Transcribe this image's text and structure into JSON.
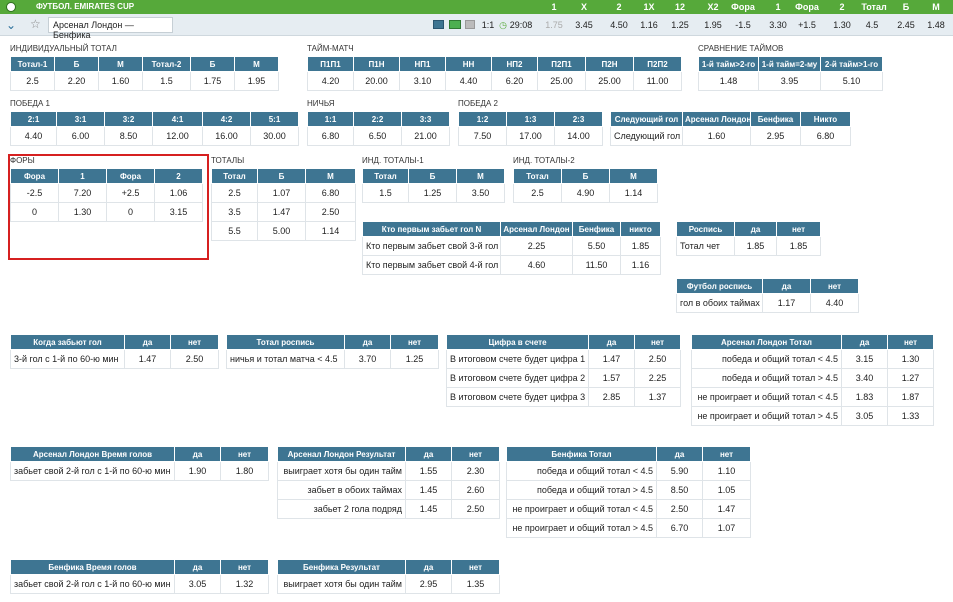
{
  "header": {
    "title": "ФУТБОЛ. EMIRATES CUP",
    "cols": [
      "1",
      "X",
      "2",
      "1X",
      "12",
      "X2",
      "Фора",
      "1",
      "Фора",
      "2",
      "Тотал",
      "Б",
      "М"
    ]
  },
  "match": {
    "name": "Арсенал Лондон — Бенфика",
    "score": "1:1",
    "time": "29:08",
    "odds": [
      "1.75",
      "3.45",
      "4.50",
      "1.16",
      "1.25",
      "1.95",
      "-1.5",
      "3.30",
      "+1.5",
      "1.30",
      "4.5",
      "2.45",
      "1.48"
    ]
  },
  "sections": {
    "ind_total": {
      "title": "ИНДИВИДУАЛЬНЫЙ ТОТАЛ",
      "head": [
        "Тотал-1",
        "Б",
        "М",
        "Тотал-2",
        "Б",
        "М"
      ],
      "rows": [
        [
          "2.5",
          "2.20",
          "1.60",
          "1.5",
          "1.75",
          "1.95"
        ]
      ]
    },
    "time_match": {
      "title": "ТАЙМ-МАТЧ",
      "head": [
        "П1П1",
        "П1Н",
        "НП1",
        "НН",
        "НП2",
        "П2П1",
        "П2Н",
        "П2П2"
      ],
      "rows": [
        [
          "4.20",
          "20.00",
          "3.10",
          "4.40",
          "6.20",
          "25.00",
          "25.00",
          "11.00"
        ]
      ]
    },
    "halves": {
      "title": "СРАВНЕНИЕ ТАЙМОВ",
      "head": [
        "1-й тайм>2-го",
        "1-й тайм=2-му",
        "2-й тайм>1-го"
      ],
      "rows": [
        [
          "1.48",
          "3.95",
          "5.10"
        ]
      ]
    },
    "win1": {
      "title": "ПОБЕДА 1",
      "head": [
        "2:1",
        "3:1",
        "3:2",
        "4:1",
        "4:2",
        "5:1"
      ],
      "rows": [
        [
          "4.40",
          "6.00",
          "8.50",
          "12.00",
          "16.00",
          "30.00"
        ]
      ]
    },
    "draw": {
      "title": "НИЧЬЯ",
      "head": [
        "1:1",
        "2:2",
        "3:3"
      ],
      "rows": [
        [
          "6.80",
          "6.50",
          "21.00"
        ]
      ]
    },
    "win2": {
      "title": "ПОБЕДА 2",
      "head": [
        "1:2",
        "1:3",
        "2:3"
      ],
      "rows": [
        [
          "7.50",
          "17.00",
          "14.00"
        ]
      ]
    },
    "next_goal": {
      "head": [
        "Следующий гол",
        "Арсенал Лондон",
        "Бенфика",
        "Никто"
      ],
      "rows": [
        [
          "Следующий гол",
          "1.60",
          "2.95",
          "6.80"
        ]
      ]
    },
    "handicap": {
      "title": "ФОРЫ",
      "head": [
        "Фора",
        "1",
        "Фора",
        "2"
      ],
      "rows": [
        [
          "-2.5",
          "7.20",
          "+2.5",
          "1.06"
        ],
        [
          "0",
          "1.30",
          "0",
          "3.15"
        ]
      ]
    },
    "totals": {
      "title": "ТОТАЛЫ",
      "head": [
        "Тотал",
        "Б",
        "М"
      ],
      "rows": [
        [
          "2.5",
          "1.07",
          "6.80"
        ],
        [
          "3.5",
          "1.47",
          "2.50"
        ],
        [
          "5.5",
          "5.00",
          "1.14"
        ]
      ]
    },
    "ind_tot1": {
      "title": "ИНД. ТОТАЛЫ-1",
      "head": [
        "Тотал",
        "Б",
        "М"
      ],
      "rows": [
        [
          "1.5",
          "1.25",
          "3.50"
        ]
      ]
    },
    "ind_tot2": {
      "title": "ИНД. ТОТАЛЫ-2",
      "head": [
        "Тотал",
        "Б",
        "М"
      ],
      "rows": [
        [
          "2.5",
          "4.90",
          "1.14"
        ]
      ]
    },
    "first_scorer": {
      "head": [
        "Кто первым забьет гол N",
        "Арсенал Лондон",
        "Бенфика",
        "никто"
      ],
      "rows": [
        [
          "Кто первым забьет свой 3-й гол",
          "2.25",
          "5.50",
          "1.85"
        ],
        [
          "Кто первым забьет свой 4-й гол",
          "4.60",
          "11.50",
          "1.16"
        ]
      ]
    },
    "draw_score": {
      "head": [
        "Роспись",
        "да",
        "нет"
      ],
      "rows": [
        [
          "Тотал чет",
          "1.85",
          "1.85"
        ]
      ]
    },
    "football_draw": {
      "head": [
        "Футбол роспись",
        "да",
        "нет"
      ],
      "rows": [
        [
          "гол в обоих таймах",
          "1.17",
          "4.40"
        ]
      ]
    },
    "when_score": {
      "head": [
        "Когда забьют гол",
        "да",
        "нет"
      ],
      "rows": [
        [
          "3-й гол с 1-й по 60-ю мин",
          "1.47",
          "2.50"
        ]
      ]
    },
    "total_draw": {
      "head": [
        "Тотал роспись",
        "да",
        "нет"
      ],
      "rows": [
        [
          "ничья и тотал матча < 4.5",
          "3.70",
          "1.25"
        ]
      ]
    },
    "digit": {
      "head": [
        "Цифра в счете",
        "да",
        "нет"
      ],
      "rows": [
        [
          "В итоговом счете будет цифра 1",
          "1.47",
          "2.50"
        ],
        [
          "В итоговом счете будет цифра 2",
          "1.57",
          "2.25"
        ],
        [
          "В итоговом счете будет цифра 3",
          "2.85",
          "1.37"
        ]
      ]
    },
    "arsenal_total": {
      "head": [
        "Арсенал Лондон Тотал",
        "да",
        "нет"
      ],
      "rows": [
        [
          "победа и общий тотал < 4.5",
          "3.15",
          "1.30"
        ],
        [
          "победа и общий тотал > 4.5",
          "3.40",
          "1.27"
        ],
        [
          "не проиграет и общий тотал < 4.5",
          "1.83",
          "1.87"
        ],
        [
          "не проиграет и общий тотал > 4.5",
          "3.05",
          "1.33"
        ]
      ]
    },
    "arsenal_time": {
      "head": [
        "Арсенал Лондон Время голов",
        "да",
        "нет"
      ],
      "rows": [
        [
          "забьет свой 2-й гол с 1-й по 60-ю мин",
          "1.90",
          "1.80"
        ]
      ]
    },
    "arsenal_result": {
      "head": [
        "Арсенал Лондон Результат",
        "да",
        "нет"
      ],
      "rows": [
        [
          "выиграет хотя бы один тайм",
          "1.55",
          "2.30"
        ],
        [
          "забьет в обоих таймах",
          "1.45",
          "2.60"
        ],
        [
          "забьет 2 гола подряд",
          "1.45",
          "2.50"
        ]
      ]
    },
    "benfica_total": {
      "head": [
        "Бенфика Тотал",
        "да",
        "нет"
      ],
      "rows": [
        [
          "победа и общий тотал < 4.5",
          "5.90",
          "1.10"
        ],
        [
          "победа и общий тотал > 4.5",
          "8.50",
          "1.05"
        ],
        [
          "не проиграет и общий тотал < 4.5",
          "2.50",
          "1.47"
        ],
        [
          "не проиграет и общий тотал > 4.5",
          "6.70",
          "1.07"
        ]
      ]
    },
    "benfica_time": {
      "head": [
        "Бенфика Время голов",
        "да",
        "нет"
      ],
      "rows": [
        [
          "забьет свой 2-й гол с 1-й по 60-ю мин",
          "3.05",
          "1.32"
        ]
      ]
    },
    "benfica_result": {
      "head": [
        "Бенфика Результат",
        "да",
        "нет"
      ],
      "rows": [
        [
          "выиграет хотя бы один тайм",
          "2.95",
          "1.35"
        ]
      ]
    }
  }
}
